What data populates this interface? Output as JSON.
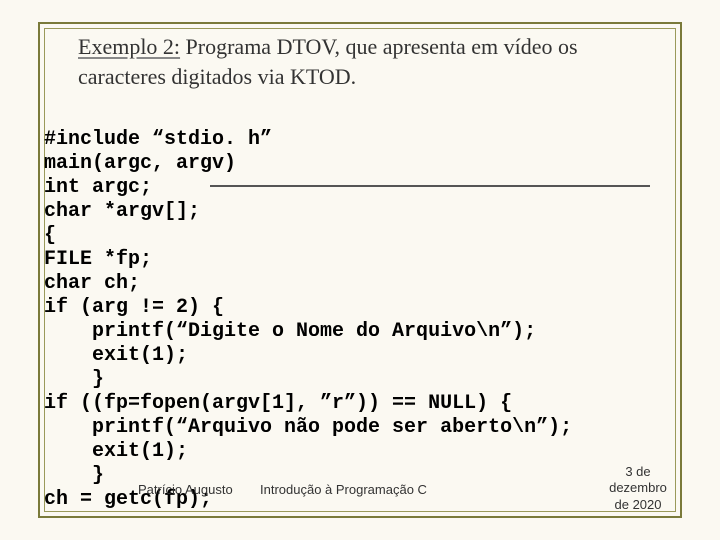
{
  "title": {
    "line1_under": "Exemplo 2:",
    "line1_rest": " Programa DTOV, que apresenta em vídeo os",
    "line2": "caracteres digitados via KTOD."
  },
  "code_lines": [
    "#include “stdio. h”",
    "main(argc, argv)",
    "int argc;",
    "char *argv[];",
    "{",
    "FILE *fp;",
    "char ch;",
    "if (arg != 2) {",
    "    printf(“Digite o Nome do Arquivo\\n”);",
    "    exit(1);",
    "    }",
    "if ((fp=fopen(argv[1], ”r”)) == NULL) {",
    "    printf(“Arquivo não pode ser aberto\\n”);",
    "    exit(1);",
    "    }",
    "ch = getc(fp);"
  ],
  "footer": {
    "author": "Patrício Augusto",
    "course": "Introdução à Programação C",
    "date_line1": "3 de",
    "date_line2": "dezembro",
    "date_line3": "de 2020"
  }
}
